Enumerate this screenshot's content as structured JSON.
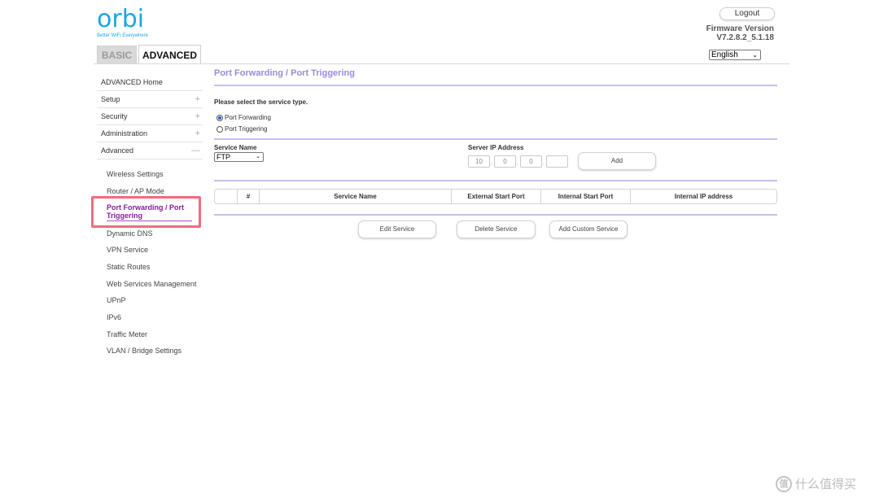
{
  "header": {
    "logo_text": "orbi",
    "logo_tagline": "Better WiFi Everywhere",
    "logout_label": "Logout",
    "firmware_label": "Firmware Version",
    "firmware_value": "V7.2.8.2_5.1.18",
    "language_selected": "English"
  },
  "tabs": {
    "basic": "BASIC",
    "advanced": "ADVANCED"
  },
  "sidebar": {
    "top_items": [
      {
        "label": "ADVANCED Home",
        "marker": ""
      },
      {
        "label": "Setup",
        "marker": "+"
      },
      {
        "label": "Security",
        "marker": "+"
      },
      {
        "label": "Administration",
        "marker": "+"
      },
      {
        "label": "Advanced",
        "marker": "—"
      }
    ],
    "sub_items": [
      "Wireless Settings",
      "Router / AP Mode",
      "Port Forwarding / Port Triggering",
      "Dynamic DNS",
      "VPN Service",
      "Static Routes",
      "Web Services Management",
      "UPnP",
      "IPv6",
      "Traffic Meter",
      "VLAN / Bridge Settings"
    ],
    "active_sub_item": "Port Forwarding / Port Triggering"
  },
  "main": {
    "title": "Port Forwarding / Port Triggering",
    "prompt": "Please select the service type.",
    "radio_forwarding": "Port Forwarding",
    "radio_triggering": "Port Triggering",
    "selected_radio": "Port Forwarding",
    "service_name_label": "Service Name",
    "service_name_value": "FTP",
    "server_ip_label": "Server IP Address",
    "server_ip": [
      "10",
      "0",
      "0",
      ""
    ],
    "add_label": "Add",
    "table_headers": [
      "",
      "#",
      "Service Name",
      "External Start Port",
      "Internal Start Port",
      "Internal IP address"
    ],
    "edit_label": "Edit Service",
    "delete_label": "Delete Service",
    "add_custom_label": "Add Custom Service"
  },
  "watermark": {
    "glyph": "值",
    "text": "什么值得买"
  },
  "colors": {
    "brand": "#1aa7e0",
    "accent_title": "#9b8bd8",
    "active_item": "#8a1aa0",
    "highlight": "#f26b7d"
  }
}
